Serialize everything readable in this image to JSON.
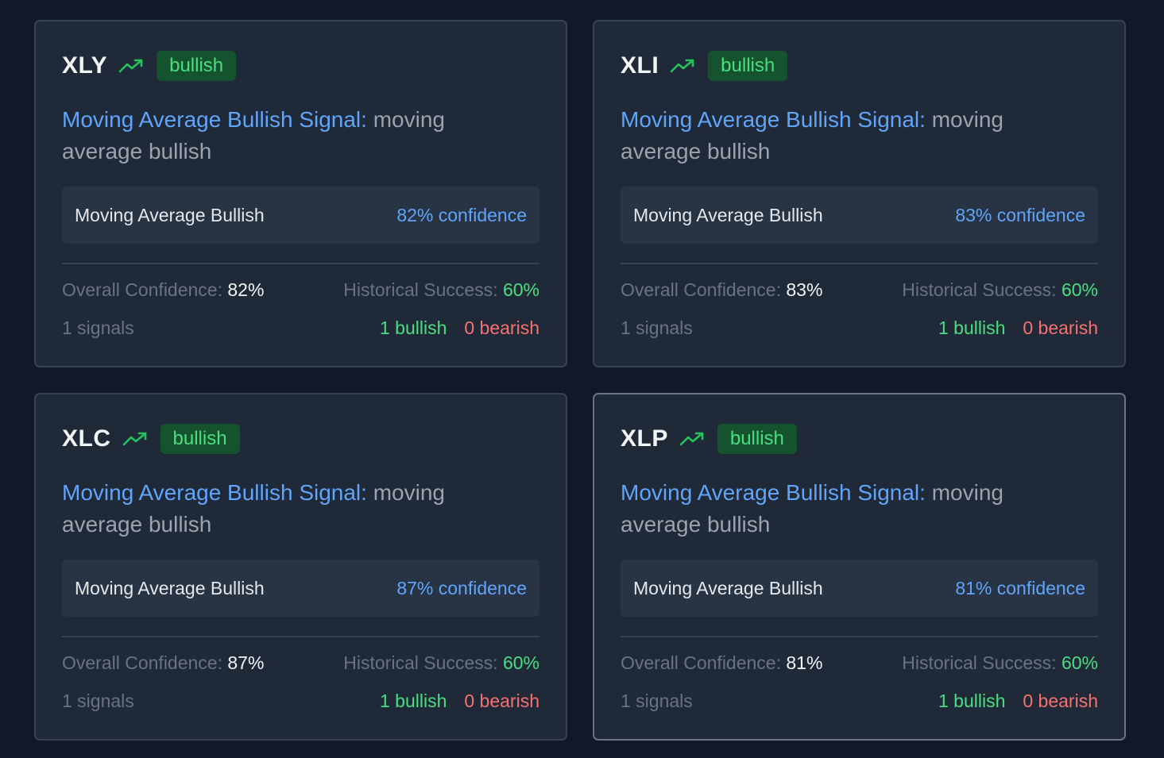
{
  "cards": [
    {
      "ticker": "XLY",
      "badge": "bullish",
      "signal_label": "Moving Average Bullish Signal:",
      "signal_desc": "moving average bullish",
      "signal_name": "Moving Average Bullish",
      "signal_confidence": "82% confidence",
      "overall_label": "Overall Confidence:",
      "overall_value": "82%",
      "history_label": "Historical Success:",
      "history_value": "60%",
      "signals_count": "1 signals",
      "bullish_count": "1 bullish",
      "bearish_count": "0 bearish"
    },
    {
      "ticker": "XLI",
      "badge": "bullish",
      "signal_label": "Moving Average Bullish Signal:",
      "signal_desc": "moving average bullish",
      "signal_name": "Moving Average Bullish",
      "signal_confidence": "83% confidence",
      "overall_label": "Overall Confidence:",
      "overall_value": "83%",
      "history_label": "Historical Success:",
      "history_value": "60%",
      "signals_count": "1 signals",
      "bullish_count": "1 bullish",
      "bearish_count": "0 bearish"
    },
    {
      "ticker": "XLC",
      "badge": "bullish",
      "signal_label": "Moving Average Bullish Signal:",
      "signal_desc": "moving average bullish",
      "signal_name": "Moving Average Bullish",
      "signal_confidence": "87% confidence",
      "overall_label": "Overall Confidence:",
      "overall_value": "87%",
      "history_label": "Historical Success:",
      "history_value": "60%",
      "signals_count": "1 signals",
      "bullish_count": "1 bullish",
      "bearish_count": "0 bearish"
    },
    {
      "ticker": "XLP",
      "badge": "bullish",
      "signal_label": "Moving Average Bullish Signal:",
      "signal_desc": "moving average bullish",
      "signal_name": "Moving Average Bullish",
      "signal_confidence": "81% confidence",
      "overall_label": "Overall Confidence:",
      "overall_value": "81%",
      "history_label": "Historical Success:",
      "history_value": "60%",
      "signals_count": "1 signals",
      "bullish_count": "1 bullish",
      "bearish_count": "0 bearish"
    }
  ],
  "icons": {
    "trend": "trending-up-icon"
  },
  "colors": {
    "background": "#111827",
    "card": "#1f2937",
    "accent_blue": "#60a5fa",
    "bullish_green": "#4ade80",
    "bearish_red": "#f87171"
  }
}
